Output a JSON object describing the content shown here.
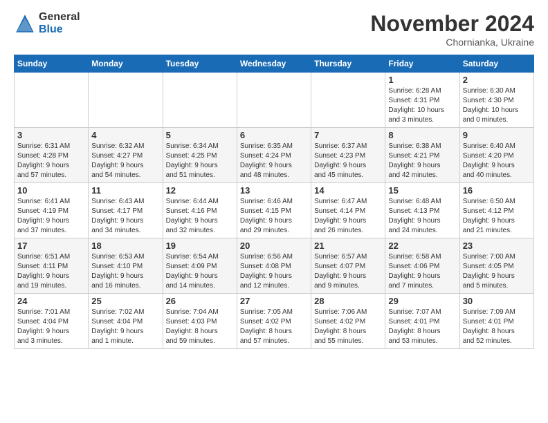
{
  "logo": {
    "general": "General",
    "blue": "Blue"
  },
  "title": "November 2024",
  "location": "Chornianka, Ukraine",
  "weekdays": [
    "Sunday",
    "Monday",
    "Tuesday",
    "Wednesday",
    "Thursday",
    "Friday",
    "Saturday"
  ],
  "weeks": [
    [
      {
        "day": "",
        "info": ""
      },
      {
        "day": "",
        "info": ""
      },
      {
        "day": "",
        "info": ""
      },
      {
        "day": "",
        "info": ""
      },
      {
        "day": "",
        "info": ""
      },
      {
        "day": "1",
        "info": "Sunrise: 6:28 AM\nSunset: 4:31 PM\nDaylight: 10 hours\nand 3 minutes."
      },
      {
        "day": "2",
        "info": "Sunrise: 6:30 AM\nSunset: 4:30 PM\nDaylight: 10 hours\nand 0 minutes."
      }
    ],
    [
      {
        "day": "3",
        "info": "Sunrise: 6:31 AM\nSunset: 4:28 PM\nDaylight: 9 hours\nand 57 minutes."
      },
      {
        "day": "4",
        "info": "Sunrise: 6:32 AM\nSunset: 4:27 PM\nDaylight: 9 hours\nand 54 minutes."
      },
      {
        "day": "5",
        "info": "Sunrise: 6:34 AM\nSunset: 4:25 PM\nDaylight: 9 hours\nand 51 minutes."
      },
      {
        "day": "6",
        "info": "Sunrise: 6:35 AM\nSunset: 4:24 PM\nDaylight: 9 hours\nand 48 minutes."
      },
      {
        "day": "7",
        "info": "Sunrise: 6:37 AM\nSunset: 4:23 PM\nDaylight: 9 hours\nand 45 minutes."
      },
      {
        "day": "8",
        "info": "Sunrise: 6:38 AM\nSunset: 4:21 PM\nDaylight: 9 hours\nand 42 minutes."
      },
      {
        "day": "9",
        "info": "Sunrise: 6:40 AM\nSunset: 4:20 PM\nDaylight: 9 hours\nand 40 minutes."
      }
    ],
    [
      {
        "day": "10",
        "info": "Sunrise: 6:41 AM\nSunset: 4:19 PM\nDaylight: 9 hours\nand 37 minutes."
      },
      {
        "day": "11",
        "info": "Sunrise: 6:43 AM\nSunset: 4:17 PM\nDaylight: 9 hours\nand 34 minutes."
      },
      {
        "day": "12",
        "info": "Sunrise: 6:44 AM\nSunset: 4:16 PM\nDaylight: 9 hours\nand 32 minutes."
      },
      {
        "day": "13",
        "info": "Sunrise: 6:46 AM\nSunset: 4:15 PM\nDaylight: 9 hours\nand 29 minutes."
      },
      {
        "day": "14",
        "info": "Sunrise: 6:47 AM\nSunset: 4:14 PM\nDaylight: 9 hours\nand 26 minutes."
      },
      {
        "day": "15",
        "info": "Sunrise: 6:48 AM\nSunset: 4:13 PM\nDaylight: 9 hours\nand 24 minutes."
      },
      {
        "day": "16",
        "info": "Sunrise: 6:50 AM\nSunset: 4:12 PM\nDaylight: 9 hours\nand 21 minutes."
      }
    ],
    [
      {
        "day": "17",
        "info": "Sunrise: 6:51 AM\nSunset: 4:11 PM\nDaylight: 9 hours\nand 19 minutes."
      },
      {
        "day": "18",
        "info": "Sunrise: 6:53 AM\nSunset: 4:10 PM\nDaylight: 9 hours\nand 16 minutes."
      },
      {
        "day": "19",
        "info": "Sunrise: 6:54 AM\nSunset: 4:09 PM\nDaylight: 9 hours\nand 14 minutes."
      },
      {
        "day": "20",
        "info": "Sunrise: 6:56 AM\nSunset: 4:08 PM\nDaylight: 9 hours\nand 12 minutes."
      },
      {
        "day": "21",
        "info": "Sunrise: 6:57 AM\nSunset: 4:07 PM\nDaylight: 9 hours\nand 9 minutes."
      },
      {
        "day": "22",
        "info": "Sunrise: 6:58 AM\nSunset: 4:06 PM\nDaylight: 9 hours\nand 7 minutes."
      },
      {
        "day": "23",
        "info": "Sunrise: 7:00 AM\nSunset: 4:05 PM\nDaylight: 9 hours\nand 5 minutes."
      }
    ],
    [
      {
        "day": "24",
        "info": "Sunrise: 7:01 AM\nSunset: 4:04 PM\nDaylight: 9 hours\nand 3 minutes."
      },
      {
        "day": "25",
        "info": "Sunrise: 7:02 AM\nSunset: 4:04 PM\nDaylight: 9 hours\nand 1 minute."
      },
      {
        "day": "26",
        "info": "Sunrise: 7:04 AM\nSunset: 4:03 PM\nDaylight: 8 hours\nand 59 minutes."
      },
      {
        "day": "27",
        "info": "Sunrise: 7:05 AM\nSunset: 4:02 PM\nDaylight: 8 hours\nand 57 minutes."
      },
      {
        "day": "28",
        "info": "Sunrise: 7:06 AM\nSunset: 4:02 PM\nDaylight: 8 hours\nand 55 minutes."
      },
      {
        "day": "29",
        "info": "Sunrise: 7:07 AM\nSunset: 4:01 PM\nDaylight: 8 hours\nand 53 minutes."
      },
      {
        "day": "30",
        "info": "Sunrise: 7:09 AM\nSunset: 4:01 PM\nDaylight: 8 hours\nand 52 minutes."
      }
    ]
  ]
}
